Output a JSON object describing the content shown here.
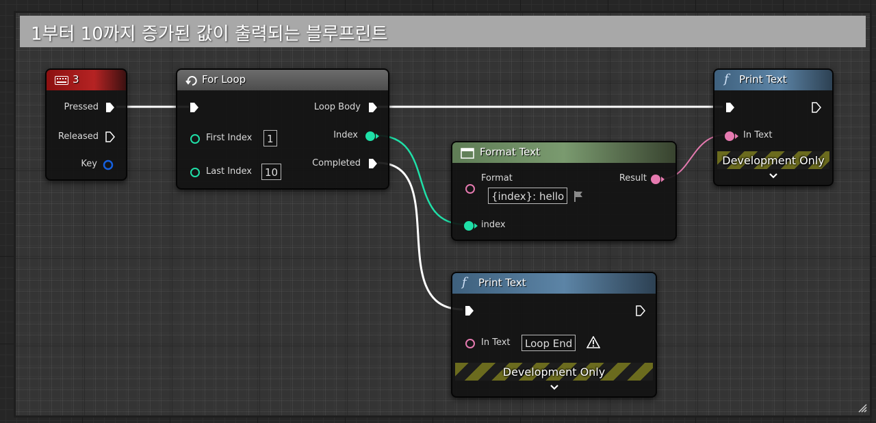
{
  "comment": {
    "title": "1부터 10까지 증가된 값이 출력되는 블루프린트"
  },
  "key_event": {
    "title": "3",
    "pins": {
      "pressed": "Pressed",
      "released": "Released",
      "key": "Key"
    }
  },
  "for_loop": {
    "title": "For Loop",
    "pins": {
      "first_index": "First Index",
      "last_index": "Last Index",
      "loop_body": "Loop Body",
      "index": "Index",
      "completed": "Completed"
    },
    "first_index_value": "1",
    "last_index_value": "10"
  },
  "format_text": {
    "title": "Format Text",
    "pins": {
      "format": "Format",
      "result": "Result",
      "index": "index"
    },
    "format_value": "{index}: hello"
  },
  "print_text_top": {
    "title": "Print Text",
    "pins": {
      "in_text": "In Text"
    },
    "dev_label": "Development Only"
  },
  "print_text_bottom": {
    "title": "Print Text",
    "pins": {
      "in_text": "In Text"
    },
    "in_text_value": "Loop End",
    "dev_label": "Development Only"
  },
  "colors": {
    "exec": "#ffffff",
    "integer": "#1fe0a8",
    "text": "#e67ab0",
    "struct": "#1560e0"
  },
  "icons": [
    "keyboard-icon",
    "loop-icon",
    "format-text-icon",
    "function-icon",
    "flag-icon",
    "warning-icon",
    "chevron-down-icon",
    "exec-pin-icon",
    "data-pin-icon"
  ]
}
